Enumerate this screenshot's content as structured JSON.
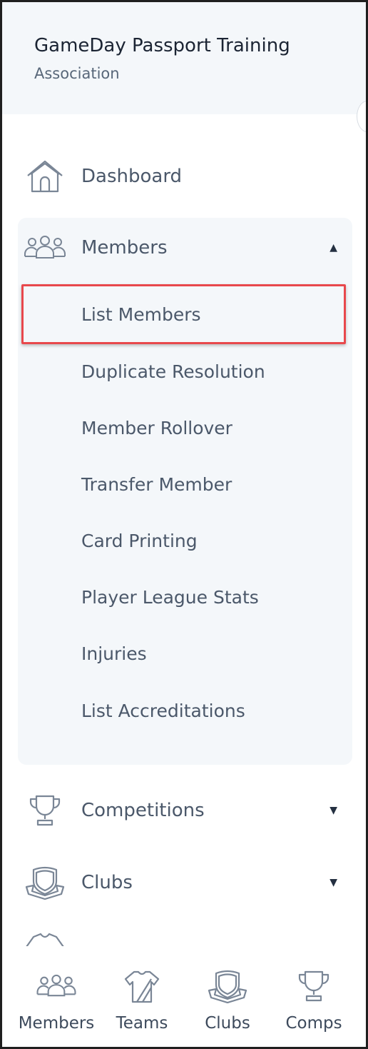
{
  "header": {
    "org_name": "GameDay Passport Training",
    "org_type": "Association"
  },
  "nav": {
    "dashboard": {
      "label": "Dashboard",
      "icon": "home-icon"
    },
    "members": {
      "label": "Members",
      "icon": "members-icon",
      "expanded": true,
      "items": [
        {
          "label": "List Members",
          "highlighted": true
        },
        {
          "label": "Duplicate Resolution"
        },
        {
          "label": "Member Rollover"
        },
        {
          "label": "Transfer Member"
        },
        {
          "label": "Card Printing"
        },
        {
          "label": "Player League Stats"
        },
        {
          "label": "Injuries"
        },
        {
          "label": "List Accreditations"
        }
      ]
    },
    "competitions": {
      "label": "Competitions",
      "icon": "trophy-icon"
    },
    "clubs": {
      "label": "Clubs",
      "icon": "shield-icon"
    }
  },
  "bottom_tabs": [
    {
      "label": "Members",
      "icon": "members-icon"
    },
    {
      "label": "Teams",
      "icon": "jersey-icon"
    },
    {
      "label": "Clubs",
      "icon": "shield-icon"
    },
    {
      "label": "Comps",
      "icon": "trophy-icon"
    }
  ],
  "colors": {
    "highlight_border": "#e8484c",
    "panel_bg": "#f4f7fa",
    "text": "#4b586a",
    "icon_stroke": "#7a8696"
  }
}
